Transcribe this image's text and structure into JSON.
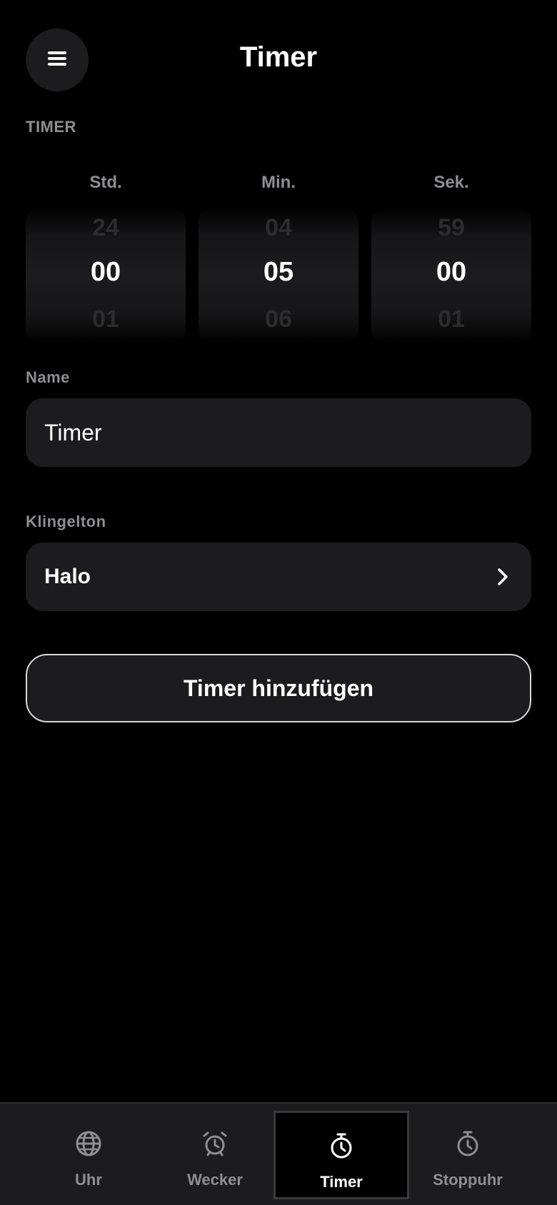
{
  "header": {
    "title": "Timer",
    "menu_icon": "hamburger-menu-icon"
  },
  "timer_section": {
    "label": "TIMER",
    "columns": [
      {
        "label": "Std.",
        "prev": "24",
        "current": "00",
        "next": "01"
      },
      {
        "label": "Min.",
        "prev": "04",
        "current": "05",
        "next": "06"
      },
      {
        "label": "Sek.",
        "prev": "59",
        "current": "00",
        "next": "01"
      }
    ]
  },
  "name_field": {
    "label": "Name",
    "value": "Timer"
  },
  "ringtone": {
    "label": "Klingelton",
    "value": "Halo",
    "icon": "chevron-right-icon"
  },
  "add_button": {
    "label": "Timer hinzufügen"
  },
  "tab_bar": {
    "tabs": [
      {
        "label": "Uhr",
        "icon": "globe-icon",
        "active": false
      },
      {
        "label": "Wecker",
        "icon": "alarm-clock-icon",
        "active": false
      },
      {
        "label": "Timer",
        "icon": "timer-icon",
        "active": true
      },
      {
        "label": "Stoppuhr",
        "icon": "stopwatch-icon",
        "active": false
      }
    ]
  },
  "colors": {
    "background": "#000000",
    "surface": "#1c1c1e",
    "secondary_text": "#8e8e93",
    "faded_number": "#2c2c2e",
    "primary_text": "#ffffff"
  }
}
